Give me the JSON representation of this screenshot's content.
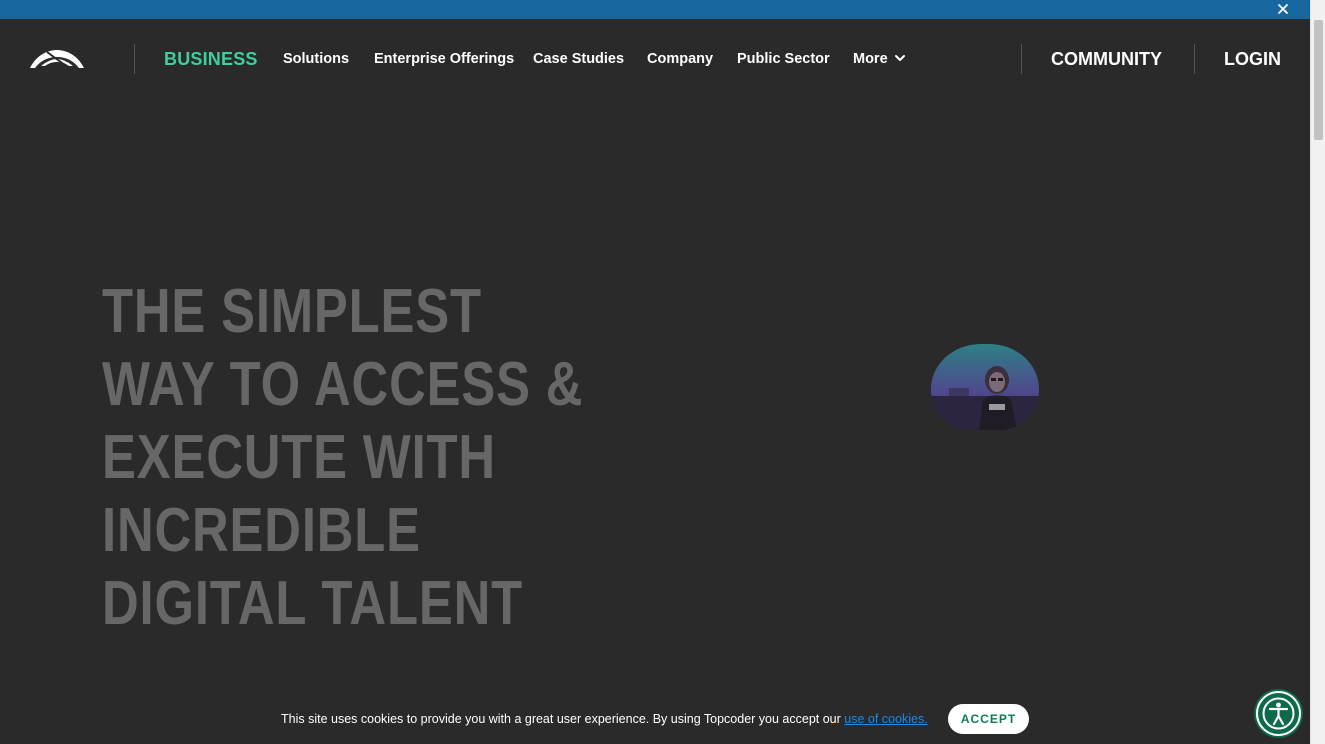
{
  "colors": {
    "background": "#2a2a2a",
    "top_banner": "#17679e",
    "accent_green": "#3fcf9f",
    "hero_text": "#676767",
    "link_blue": "#1e88e5",
    "accessibility_green": "#0d6a4a"
  },
  "banner": {
    "close_icon": "close-icon"
  },
  "nav": {
    "logo_icon": "topcoder-logo-icon",
    "business": "BUSINESS",
    "items": [
      "Solutions",
      "Enterprise Offerings",
      "Case Studies",
      "Company",
      "Public Sector",
      "More"
    ],
    "more_icon": "chevron-down-icon",
    "community": "COMMUNITY",
    "login": "LOGIN"
  },
  "hero": {
    "lines": [
      "THE SIMPLEST",
      "WAY TO ACCESS &",
      "EXECUTE WITH",
      "INCREDIBLE",
      "DIGITAL TALENT"
    ]
  },
  "cookie": {
    "text": "This site uses cookies to provide you with a great user experience. By using Topcoder you accept our ",
    "link": "use of cookies.",
    "accept": "ACCEPT"
  },
  "accessibility": {
    "icon": "accessibility-icon"
  }
}
